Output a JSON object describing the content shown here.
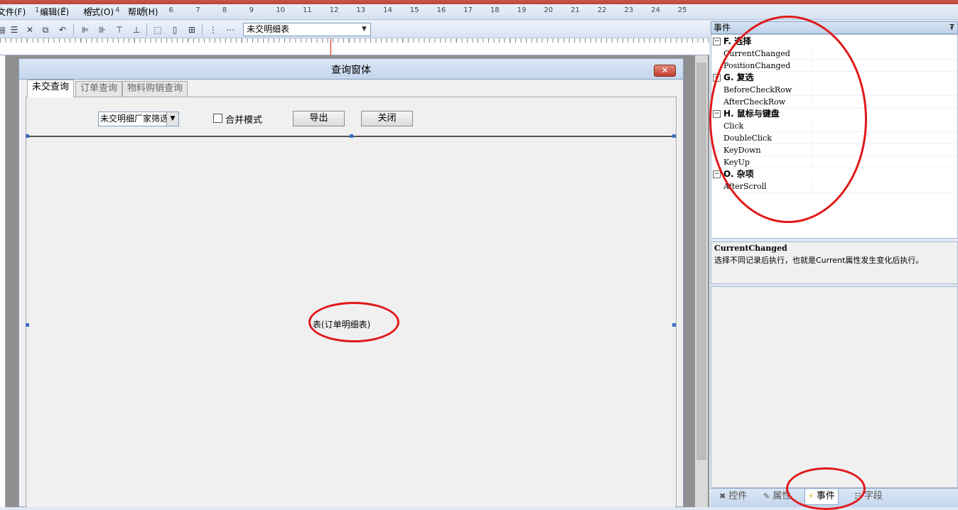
{
  "menu": [
    "文件(F)",
    "编辑(E)",
    "格式(O)",
    "帮助(H)"
  ],
  "toolbar": {
    "table_select": "未交明细表"
  },
  "ruler": [
    "1",
    "2",
    "3",
    "4",
    "5",
    "6",
    "7",
    "8",
    "9",
    "10",
    "11",
    "12",
    "13",
    "14",
    "15",
    "16",
    "17",
    "18",
    "19",
    "20",
    "21",
    "22",
    "23",
    "24",
    "25"
  ],
  "form": {
    "title": "查询窗体",
    "close_symbol": "✕",
    "tabs": [
      "未交查询",
      "订单查询",
      "物料购销查询"
    ],
    "filter_select": "未交明细厂家筛选",
    "merge_label": "合并模式",
    "export_label": "导出",
    "close_label": "关闭",
    "grid_label": "表(订单明细表)"
  },
  "panel": {
    "title": "事件",
    "pin_symbol": "₮",
    "categories": [
      {
        "label": "F. 选择",
        "events": [
          "CurrentChanged",
          "PositionChanged"
        ]
      },
      {
        "label": "G. 复选",
        "events": [
          "BeforeCheckRow",
          "AfterCheckRow"
        ]
      },
      {
        "label": "H. 鼠标与键盘",
        "events": [
          "Click",
          "DoubleClick",
          "KeyDown",
          "KeyUp"
        ]
      },
      {
        "label": "O. 杂项",
        "events": [
          "AfterScroll"
        ]
      }
    ],
    "description_title": "CurrentChanged",
    "description_text": "选择不同记录后执行，也就是Current属性发生变化后执行。",
    "bottom_tabs": [
      "控件",
      "属性",
      "事件",
      "字段"
    ],
    "active_tab": "事件"
  },
  "colors": {
    "annotation": "#e0191a",
    "titlebar": "#c9574d",
    "chrome": "#dfe8f5"
  }
}
